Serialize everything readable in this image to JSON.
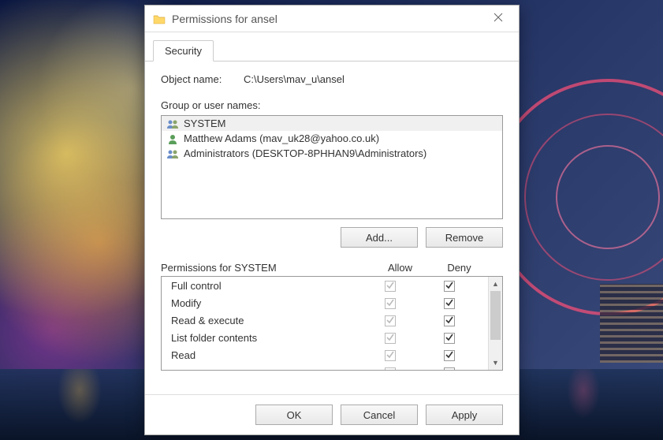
{
  "window": {
    "title": "Permissions for ansel"
  },
  "tab": {
    "security": "Security"
  },
  "object": {
    "label": "Object name:",
    "path": "C:\\Users\\mav_u\\ansel"
  },
  "group_label": "Group or user names:",
  "users": [
    {
      "icon": "group",
      "name": "SYSTEM"
    },
    {
      "icon": "user",
      "name": "Matthew Adams (mav_uk28@yahoo.co.uk)"
    },
    {
      "icon": "group",
      "name": "Administrators (DESKTOP-8PHHAN9\\Administrators)"
    }
  ],
  "buttons": {
    "add": "Add...",
    "remove": "Remove",
    "ok": "OK",
    "cancel": "Cancel",
    "apply": "Apply"
  },
  "permissions_for": "Permissions for SYSTEM",
  "columns": {
    "allow": "Allow",
    "deny": "Deny"
  },
  "permissions": [
    {
      "name": "Full control",
      "allow": true,
      "allow_disabled": true,
      "deny": true
    },
    {
      "name": "Modify",
      "allow": true,
      "allow_disabled": true,
      "deny": true
    },
    {
      "name": "Read & execute",
      "allow": true,
      "allow_disabled": true,
      "deny": true
    },
    {
      "name": "List folder contents",
      "allow": true,
      "allow_disabled": true,
      "deny": true
    },
    {
      "name": "Read",
      "allow": true,
      "allow_disabled": true,
      "deny": true
    }
  ]
}
